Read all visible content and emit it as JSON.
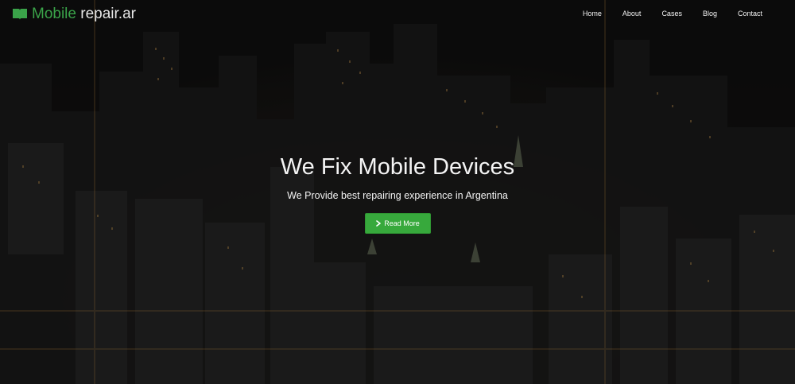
{
  "brand": {
    "primary": "Mobile",
    "secondary": " repair.ar",
    "icon": "book-icon",
    "green": "#3aa349"
  },
  "nav": {
    "items": [
      {
        "label": "Home"
      },
      {
        "label": "About"
      },
      {
        "label": "Cases"
      },
      {
        "label": "Blog"
      },
      {
        "label": "Contact"
      }
    ]
  },
  "hero": {
    "title": "We Fix Mobile Devices",
    "subtitle": "We Provide best repairing experience in Argentina",
    "cta": {
      "label": "Read More",
      "icon": "chevron-right-icon",
      "color": "#37a93c"
    },
    "background": "night-city-skyline-aerial"
  }
}
